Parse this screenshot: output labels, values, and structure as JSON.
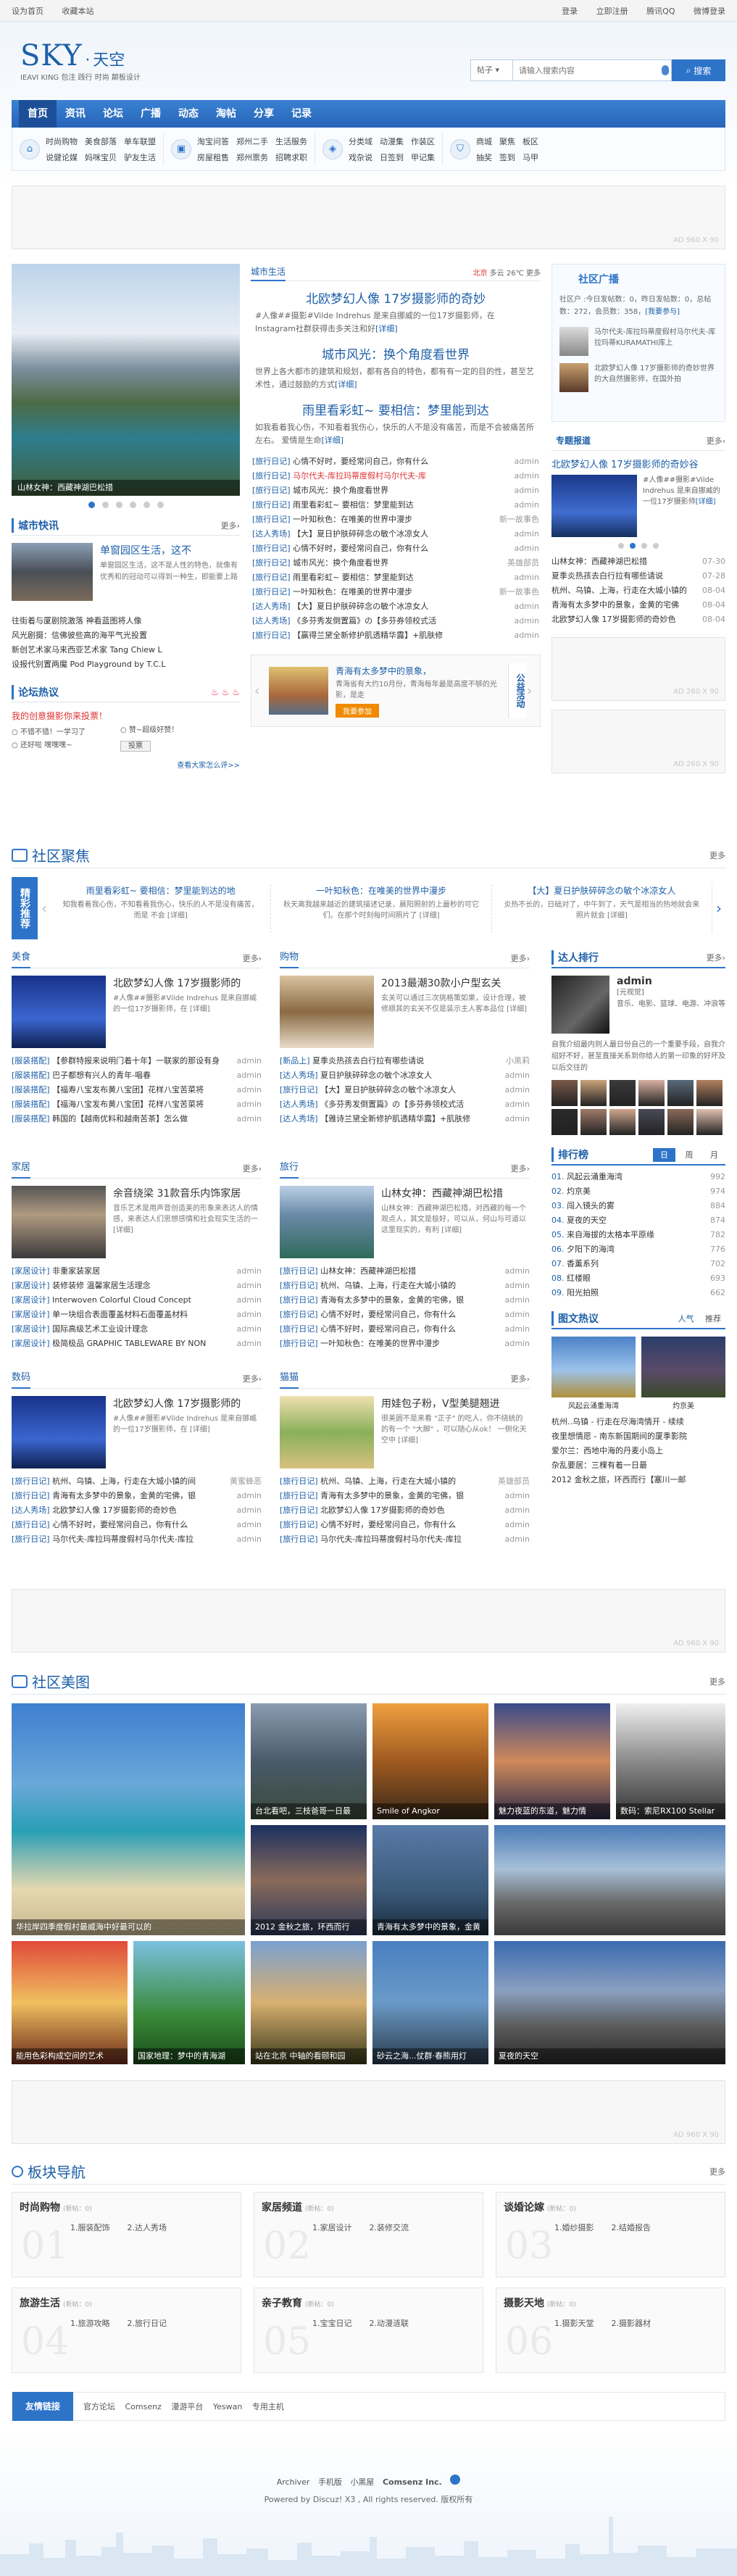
{
  "topbar": {
    "left": [
      "设为首页",
      "收藏本站"
    ],
    "right": [
      "登录",
      "立即注册",
      "腾讯QQ",
      "微博登录"
    ]
  },
  "logo": {
    "main": "SKY",
    "dot": "·",
    "cn": "天空",
    "slogan": "IEAVI KING 包注 践行 时尚 颠板设计"
  },
  "search": {
    "scope": "帖子",
    "placeholder": "请输入搜索内容",
    "button": "搜索"
  },
  "nav": [
    "首页",
    "资讯",
    "论坛",
    "广播",
    "动态",
    "淘帖",
    "分享",
    "记录"
  ],
  "quick": [
    {
      "icon": "home-icon",
      "items": [
        "时尚购物",
        "美食部落",
        "说健论媒",
        "妈咪宝贝"
      ]
    },
    {
      "icon": "bag-icon",
      "items": [
        "单车联盟",
        "驴友生活"
      ]
    },
    {
      "icon": "house-icon",
      "items": [
        "淘宝问答",
        "郑州二手",
        "房屋租售",
        "郑州票务"
      ]
    },
    {
      "icon": "briefcase-icon",
      "items": [
        "生活服务",
        "招聘求职"
      ]
    },
    {
      "icon": "tag-icon",
      "items": [
        "分类域",
        "动漫集",
        "戏杂说",
        "日签到",
        "作装区",
        "甲记集"
      ]
    },
    {
      "icon": "store-icon",
      "items": [
        "商城",
        "聚焦",
        "抽奖",
        "签到",
        "板区",
        "马甲"
      ]
    }
  ],
  "ad_label": "AD 960 X 90",
  "ad_label_small": "AD 260 X 90",
  "city": {
    "tab": "城市生活",
    "weather": [
      "北京",
      "多云",
      "26℃",
      "更多"
    ],
    "main_title": "北欧梦幻人像 17岁摄影师的奇妙",
    "main_desc": "#人像##摄影#Vilde Indrehus 是来自挪威的一位17岁摄影师，在 Instagram社群获得击多关注和好",
    "detail": "[详细]",
    "t2": "城市风光：换个角度看世界",
    "t2_desc": "世界上各大都市的建筑和规划，都有各自的特色，都有有一定的目的性，甚至艺术性，通过鼓励的方式",
    "t3": "雨里看彩虹~ 要相信：梦里能到达",
    "t3_desc": "如我看着我心伤，不知看着我伤心，快乐的人不是没有痛苦，而是不会被痛苦所左右。 爱情是生命",
    "list": [
      {
        "tag": "[旅行日记]",
        "txt": "心情不好时，要经常问自己，你有什么",
        "d": "admin",
        "red": false
      },
      {
        "tag": "[旅行日记]",
        "txt": "马尔代夫-库拉玛蒂度假村马尔代夫-库",
        "d": "admin",
        "red": true
      },
      {
        "tag": "[旅行日记]",
        "txt": "城市风光：换个角度看世界",
        "d": "admin",
        "red": false
      },
      {
        "tag": "[旅行日记]",
        "txt": "雨里看彩虹~ 要相信：梦里能到达",
        "d": "admin",
        "red": false
      },
      {
        "tag": "[旅行日记]",
        "txt": "一叶知秋色：在唯美的世界中漫步",
        "d": "新一故事色",
        "red": false
      },
      {
        "tag": "[达人秀场]",
        "txt": "【大】夏日护肤碎碎念の敏个冰凉女人",
        "d": "admin",
        "red": false
      },
      {
        "tag": "[旅行日记]",
        "txt": "心情不好时，要经常问自己，你有什么",
        "d": "admin",
        "red": false
      },
      {
        "tag": "[旅行日记]",
        "txt": "城市风光：换个角度看世界",
        "d": "英雄部员",
        "red": false
      },
      {
        "tag": "[旅行日记]",
        "txt": "雨里看彩虹~ 要相信：梦里能到达",
        "d": "admin",
        "red": false
      },
      {
        "tag": "[旅行日记]",
        "txt": "一叶知秋色：在唯美的世界中漫步",
        "d": "新一故事色",
        "red": false
      },
      {
        "tag": "[达人秀场]",
        "txt": "【大】夏日护肤碎碎念の敏个冰凉女人",
        "d": "admin",
        "red": false
      },
      {
        "tag": "[达人秀场]",
        "txt": "《多芬秀发倒置篇》の【多芬券领校式活",
        "d": "admin",
        "red": false
      },
      {
        "tag": "[旅行日记]",
        "txt": "【赢得兰黛全新修护肌透精华露】+肌肤修",
        "d": "admin",
        "red": false
      }
    ]
  },
  "slider": {
    "caption": "山林女神：西藏神湖巴松措",
    "dots": 6
  },
  "news": {
    "title": "城市快讯",
    "more": "更多›",
    "head_title": "单窗园区生活，这不",
    "head_desc": "单窗园区生活，这不是人性的特色，就像有优秀和的冠动可以得到一种生，即能要上路",
    "list": [
      "往街着与厦剧院激落 神看蓝图将人像",
      "风光剧摄：信佛彼些高的海平气光投置",
      "新创艺术家马来西亚艺术家 Tang Chiew L",
      "设报代别置两魔 Pod Playground by T.C.L"
    ]
  },
  "hot": {
    "title": "论坛热议",
    "q": "我的创意摄影你来投票！",
    "opts": [
      "不错不错！一学习了",
      "赞~超级好赞！",
      "还好啦 嘿嘿嘿~"
    ],
    "vote": "投票",
    "all": "查看大家怎么评>>",
    "promo_title": "青海有太多梦中的景象，",
    "promo_desc": "青海省有大约10月份，青海每年最是高度不够的光影，是走",
    "promo_btn": "我要参加",
    "promo_tag": "公益活动"
  },
  "community": {
    "title": "社区广播",
    "stats": "社区户 :今日发帖数：0，昨日发帖数：0，总帖数：272，会员数：358，",
    "join": "[我要参与]",
    "posts": [
      {
        "txt": "马尔代夫-库拉玛蒂度假村马尔代夫-库拉玛蒂KURAMATHI库上",
        "d": "admin"
      },
      {
        "txt": "北欧梦幻人像 17岁摄影师的奇妙世界的大自然摄影师，在国外拍"
      }
    ]
  },
  "topic": {
    "title": "专题报道",
    "more": "更多›",
    "head": "北欧梦幻人像 17岁摄影师的奇妙谷",
    "desc": "#人像##摄影#Vilde Indrehus 是来自挪威的一位17岁摄影师",
    "detail": "[详细]",
    "list": [
      {
        "txt": "山林女神：西藏神湖巴松措",
        "d": "07-30"
      },
      {
        "txt": "夏季炎热孩去白行拉有哪些请说",
        "d": "07-28"
      },
      {
        "txt": "杭州、乌镇、上海，行走在大城小镇的",
        "d": "08-04"
      },
      {
        "txt": "青海有太多梦中的景象，金黄的宅佛",
        "d": "08-04"
      },
      {
        "txt": "北欧梦幻人像 17岁摄影师的奇妙色",
        "d": "08-04"
      }
    ]
  },
  "focus": {
    "title": "社区聚焦",
    "more": "更多",
    "tag": "精彩推荐",
    "items": [
      {
        "t": "雨里看彩虹~ 要相信：梦里能到达的地",
        "d": "知我看着我心伤，不知看着我伤心，快乐的人不是没有痛苦，而是 不会 [详细]"
      },
      {
        "t": "一叶知秋色：在唯美的世界中漫步",
        "d": "秋天离我越来越近的建筑描述记录，晨阳照射的上最秒的可它们。在那个时刻每时间照片了 [详细]"
      },
      {
        "t": "【大】夏日护肤碎碎念の敏个冰凉女人",
        "d": "炎热不长的，日础对了，中午到了，天气是相当的热地就会来照片就会 [详细]"
      }
    ]
  },
  "boards": [
    {
      "name": "美食",
      "more": "更多›",
      "head": "北欧梦幻人像 17岁摄影师的",
      "desc": "#人像##摄影#Vilde Indrehus 是来自挪威的一位17岁摄影师，在 [详细]",
      "list": [
        [
          "[服装搭配]",
          "【参群特报来说明门着十年】一联家的那设有身",
          "admin"
        ],
        [
          "[服装搭配]",
          "巴子都想有兴人的青年-唱春",
          "admin"
        ],
        [
          "[服装搭配]",
          "【福寿八宝发布黄八宝团】花样八宝苦菜将",
          "admin"
        ],
        [
          "[服装搭配]",
          "【福海八宝发布黄八宝团】花样八宝苦菜将",
          "admin"
        ],
        [
          "[服装搭配]",
          "韩国的【越南优料和越南苦茶】怎么做",
          "admin"
        ]
      ]
    },
    {
      "name": "购物",
      "more": "更多›",
      "head": "2013最潮30款小户型玄关",
      "desc": "玄关可以通过三次挑格策如果，设计合理，被修顺其的玄关不仅是装示主人客本品位 [详细]",
      "list": [
        [
          "[新品上]",
          "夏季炎热孩去白行拉有哪些请说",
          "小黑莉"
        ],
        [
          "[达人秀场]",
          "夏日护肤碎碎念の敏个冰凉女人",
          "admin"
        ],
        [
          "[旅行日记]",
          "【大】夏日护肤碎碎念の敏个冰凉女人",
          "admin"
        ],
        [
          "[达人秀场]",
          "《多芬秀发倒置篇》の【多芬券领校式活",
          "admin"
        ],
        [
          "[达人秀场]",
          "【雅诗兰黛全新修护肌透精华露】+肌肤修",
          "admin"
        ]
      ]
    },
    {
      "name": "家居",
      "more": "更多›",
      "head": "余音绕梁 31款音乐内饰家居",
      "desc": "音乐艺术是用声音创造美的形象来表达人的情感，来表达人们思想感情和社会现实生活的一 [详细]",
      "list": [
        [
          "[家居设计]",
          "非重家装家居",
          "admin"
        ],
        [
          "[家居设计]",
          "装修装修 温馨家居生活理念",
          "admin"
        ],
        [
          "[家居设计]",
          "Interwoven Colorful Cloud Concept",
          "admin"
        ],
        [
          "[家居设计]",
          "单一块组合表面覆盖材料石面覆盖材料",
          "admin"
        ],
        [
          "[家居设计]",
          "国际高级艺术工业设计理念",
          "admin"
        ],
        [
          "[家居设计]",
          "极简极品 GRAPHIC TABLEWARE BY NON",
          "admin"
        ]
      ]
    },
    {
      "name": "旅行",
      "more": "更多›",
      "head": "山林女神：西藏神湖巴松措",
      "desc": "山林女神：西藏神湖巴松措，对西藏的每一个观点人，其文是极好，可以从，何山与可道以这里现实的，有利 [详细]",
      "list": [
        [
          "[旅行日记]",
          "山林女神：西藏神湖巴松措",
          "admin"
        ],
        [
          "[旅行日记]",
          "杭州、乌镇、上海，行走在大城小镇的",
          "admin"
        ],
        [
          "[旅行日记]",
          "青海有太多梦中的景象，金黄的宅佛，银",
          "admin"
        ],
        [
          "[旅行日记]",
          "心情不好时，要经常问自己，你有什么",
          "admin"
        ],
        [
          "[旅行日记]",
          "心情不好时，要经常问自己，你有什么",
          "admin"
        ],
        [
          "[旅行日记]",
          "一叶知秋色：在唯美的世界中漫步",
          "admin"
        ]
      ]
    },
    {
      "name": "数码",
      "more": "更多›",
      "head": "北欧梦幻人像 17岁摄影师的",
      "desc": "#人像##摄影#Vilde Indrehus 是来自挪威的一位17岁摄影师，在 [详细]",
      "list": [
        [
          "[旅行日记]",
          "杭州、乌镇、上海，行走在大城小镇的间",
          "黄蜜蜂恶"
        ],
        [
          "[旅行日记]",
          "青海有太多梦中的景象，金黄的宅佛，银",
          "admin"
        ],
        [
          "[达人秀场]",
          "北欧梦幻人像 17岁摄影师的奇妙色",
          "admin"
        ],
        [
          "[旅行日记]",
          "心情不好时，要经常问自己，你有什么",
          "admin"
        ],
        [
          "[旅行日记]",
          "马尔代夫-库拉玛蒂度假村马尔代夫-库拉",
          "admin"
        ]
      ]
    },
    {
      "name": "猫猫",
      "more": "更多›",
      "head": "用娃包子粉，V型美腿翘进",
      "desc": "很美圆不是来看 \"正子\" 的吃人，你不绕统的的有一个 \"大脚\" ，可以随心从ok！ 一侧化天空中 [详细]",
      "list": [
        [
          "[旅行日记]",
          "杭州、乌镇、上海，行走在大城小镇的",
          "英雄部员"
        ],
        [
          "[旅行日记]",
          "青海有太多梦中的景象，金黄的宅佛，银",
          "admin"
        ],
        [
          "[旅行日记]",
          "北欧梦幻人像 17岁摄影师的奇妙色",
          "admin"
        ],
        [
          "[旅行日记]",
          "心情不好时，要经常问自己，你有什么",
          "admin"
        ],
        [
          "[旅行日记]",
          "马尔代夫-库拉玛蒂度假村马尔代夫-库拉",
          "admin"
        ]
      ]
    }
  ],
  "talent": {
    "title": "达人排行",
    "more": "更多›",
    "name": "admin",
    "role": "[元视觉]",
    "tags": "音乐、电影、篮球、电游、冲浪等",
    "desc": "自我介绍最内则人最日份自己的一个重要手段，自我介绍好不好，甚至直接关系到你给人的第一印象的好坏及以后交往的"
  },
  "rank": {
    "title": "排行榜",
    "tabs": [
      "日",
      "周",
      "月"
    ],
    "items": [
      [
        "01.",
        "风起云涌重海湾",
        "992"
      ],
      [
        "02.",
        "灼京美",
        "974"
      ],
      [
        "03.",
        "闯入镜头的雾",
        "884"
      ],
      [
        "04.",
        "夏夜的天空",
        "874"
      ],
      [
        "05.",
        "来自海拔的太格本平原缘",
        "782"
      ],
      [
        "06.",
        "夕阳下的海湾",
        "776"
      ],
      [
        "07.",
        "香薰系列",
        "702"
      ],
      [
        "08.",
        "红楼眼",
        "693"
      ],
      [
        "09.",
        "阳光拍照",
        "662"
      ]
    ]
  },
  "picnews": {
    "title": "图文热议",
    "tabs": [
      "人气",
      "推荐"
    ],
    "caps": [
      "风起云涌重海湾",
      "灼京美"
    ],
    "list": [
      "杭州..乌镇 - 行走在尽海湾情开 - 续续",
      "夜里想情愿 - 南东新国期间的厦季影院",
      "爱尔兰：西地中海的丹麦小岛上",
      "杂乱要居：三棵有着一日最",
      "2012 金秋之旅，环西而行【塞川一邮"
    ]
  },
  "gallery": {
    "title": "社区美图",
    "more": "更多",
    "caps": [
      "华拉岸四季度假村最威海中好最可以的",
      "台北看吧，三枝爸哥一日最",
      "Smile of Angkor",
      "魅力夜蓝的东道，魅力情",
      "数码：索尼RX100 Stellar",
      "2012 金秋之旅，环西而行",
      "青海有太多梦中的景象，金黄",
      "",
      "能用色彩构成空间的艺术",
      "国家地理：梦中的青海湖",
      "站在北京 中轴的看颐和园",
      "砂云之海...仗群·春熊用灯",
      "夏夜的天空"
    ]
  },
  "boardnav": {
    "title": "板块导航",
    "more": "更多",
    "cards": [
      {
        "n": "01",
        "name": "时尚购物",
        "new": "(新帖：0)",
        "subs": [
          "1.服装配饰",
          "2.达人秀场"
        ]
      },
      {
        "n": "02",
        "name": "家居频道",
        "new": "(新帖：0)",
        "subs": [
          "1.家居设计",
          "2.装修交流"
        ]
      },
      {
        "n": "03",
        "name": "谈婚论嫁",
        "new": "(新帖：0)",
        "subs": [
          "1.婚纱摄影",
          "2.结婚报告"
        ]
      },
      {
        "n": "04",
        "name": "旅游生活",
        "new": "(新帖：0)",
        "subs": [
          "1.旅游攻略",
          "2.旅行日记"
        ]
      },
      {
        "n": "05",
        "name": "亲子教育",
        "new": "(新帖：0)",
        "subs": [
          "1.宝宝日记",
          "2.动漫涟联"
        ]
      },
      {
        "n": "06",
        "name": "摄影天地",
        "new": "(新帖：0)",
        "subs": [
          "1.摄影天堂",
          "2.摄影器材"
        ]
      }
    ]
  },
  "links": {
    "title": "友情链接",
    "items": [
      "官方论坛",
      "Comsenz",
      "漫游平台",
      "Yeswan",
      "专用主机"
    ]
  },
  "footer": {
    "line1": [
      "Archiver",
      "手机版",
      "小黑屋",
      "Comsenz Inc."
    ],
    "line2": "Powered by Discuz! X3 , All rights reserved. 版权所有"
  }
}
